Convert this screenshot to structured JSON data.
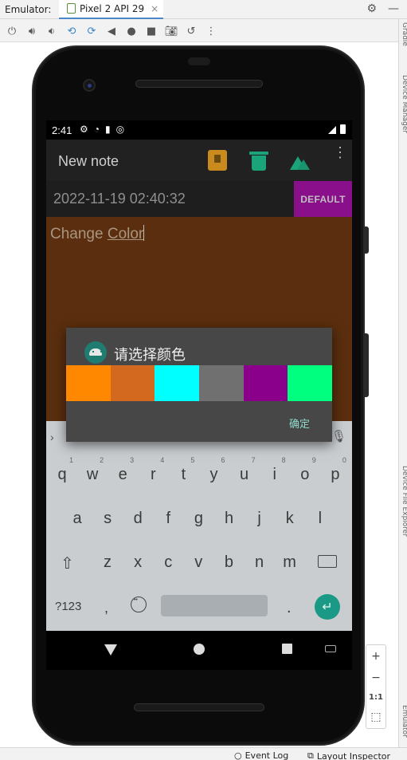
{
  "ide": {
    "emulator_label": "Emulator:",
    "tab_label": "Pixel 2 API 29",
    "tab_close": "×",
    "gear": "⚙",
    "minimize": "—",
    "right_strip_top": "Gradle",
    "right_strip_mid": "Device Manager",
    "right_strip_file": "Device File Explorer",
    "right_strip_bottom": "Emulator",
    "statusbar": {
      "event_log": "Event Log",
      "layout_inspector": "Layout Inspector"
    },
    "zoom": {
      "plus": "+",
      "minus": "−",
      "one_to_one": "1:1"
    }
  },
  "device": {
    "status_bar": {
      "time": "2:41"
    },
    "app_bar": {
      "title": "New note",
      "more": "⋮"
    },
    "date_bar": {
      "date": "2022-11-19 02:40:32",
      "default_button": "DEFAULT"
    },
    "note": {
      "text_plain": "Change ",
      "text_underlined": "Color"
    },
    "dialog": {
      "title": "请选择颜色",
      "ok_button": "确定",
      "swatches": [
        "#ff8800",
        "#d2691e",
        "#00ffff",
        "#707070",
        "#8b008b",
        "#00ff7f"
      ]
    },
    "keyboard": {
      "row1": [
        {
          "k": "q",
          "h": "1"
        },
        {
          "k": "w",
          "h": "2"
        },
        {
          "k": "e",
          "h": "3"
        },
        {
          "k": "r",
          "h": "4"
        },
        {
          "k": "t",
          "h": "5"
        },
        {
          "k": "y",
          "h": "6"
        },
        {
          "k": "u",
          "h": "7"
        },
        {
          "k": "i",
          "h": "8"
        },
        {
          "k": "o",
          "h": "9"
        },
        {
          "k": "p",
          "h": "0"
        }
      ],
      "row2": [
        "a",
        "s",
        "d",
        "f",
        "g",
        "h",
        "j",
        "k",
        "l"
      ],
      "row3": [
        "z",
        "x",
        "c",
        "v",
        "b",
        "n",
        "m"
      ],
      "sym_key": "?123",
      "comma_key": ",",
      "period_key": ".",
      "enter_key": "↵",
      "chevron": "›",
      "shift": "⇧"
    }
  },
  "colors": {
    "note_background": "#5a2e0e",
    "default_button": "#8a0f8a",
    "accent": "#1a9a86"
  }
}
